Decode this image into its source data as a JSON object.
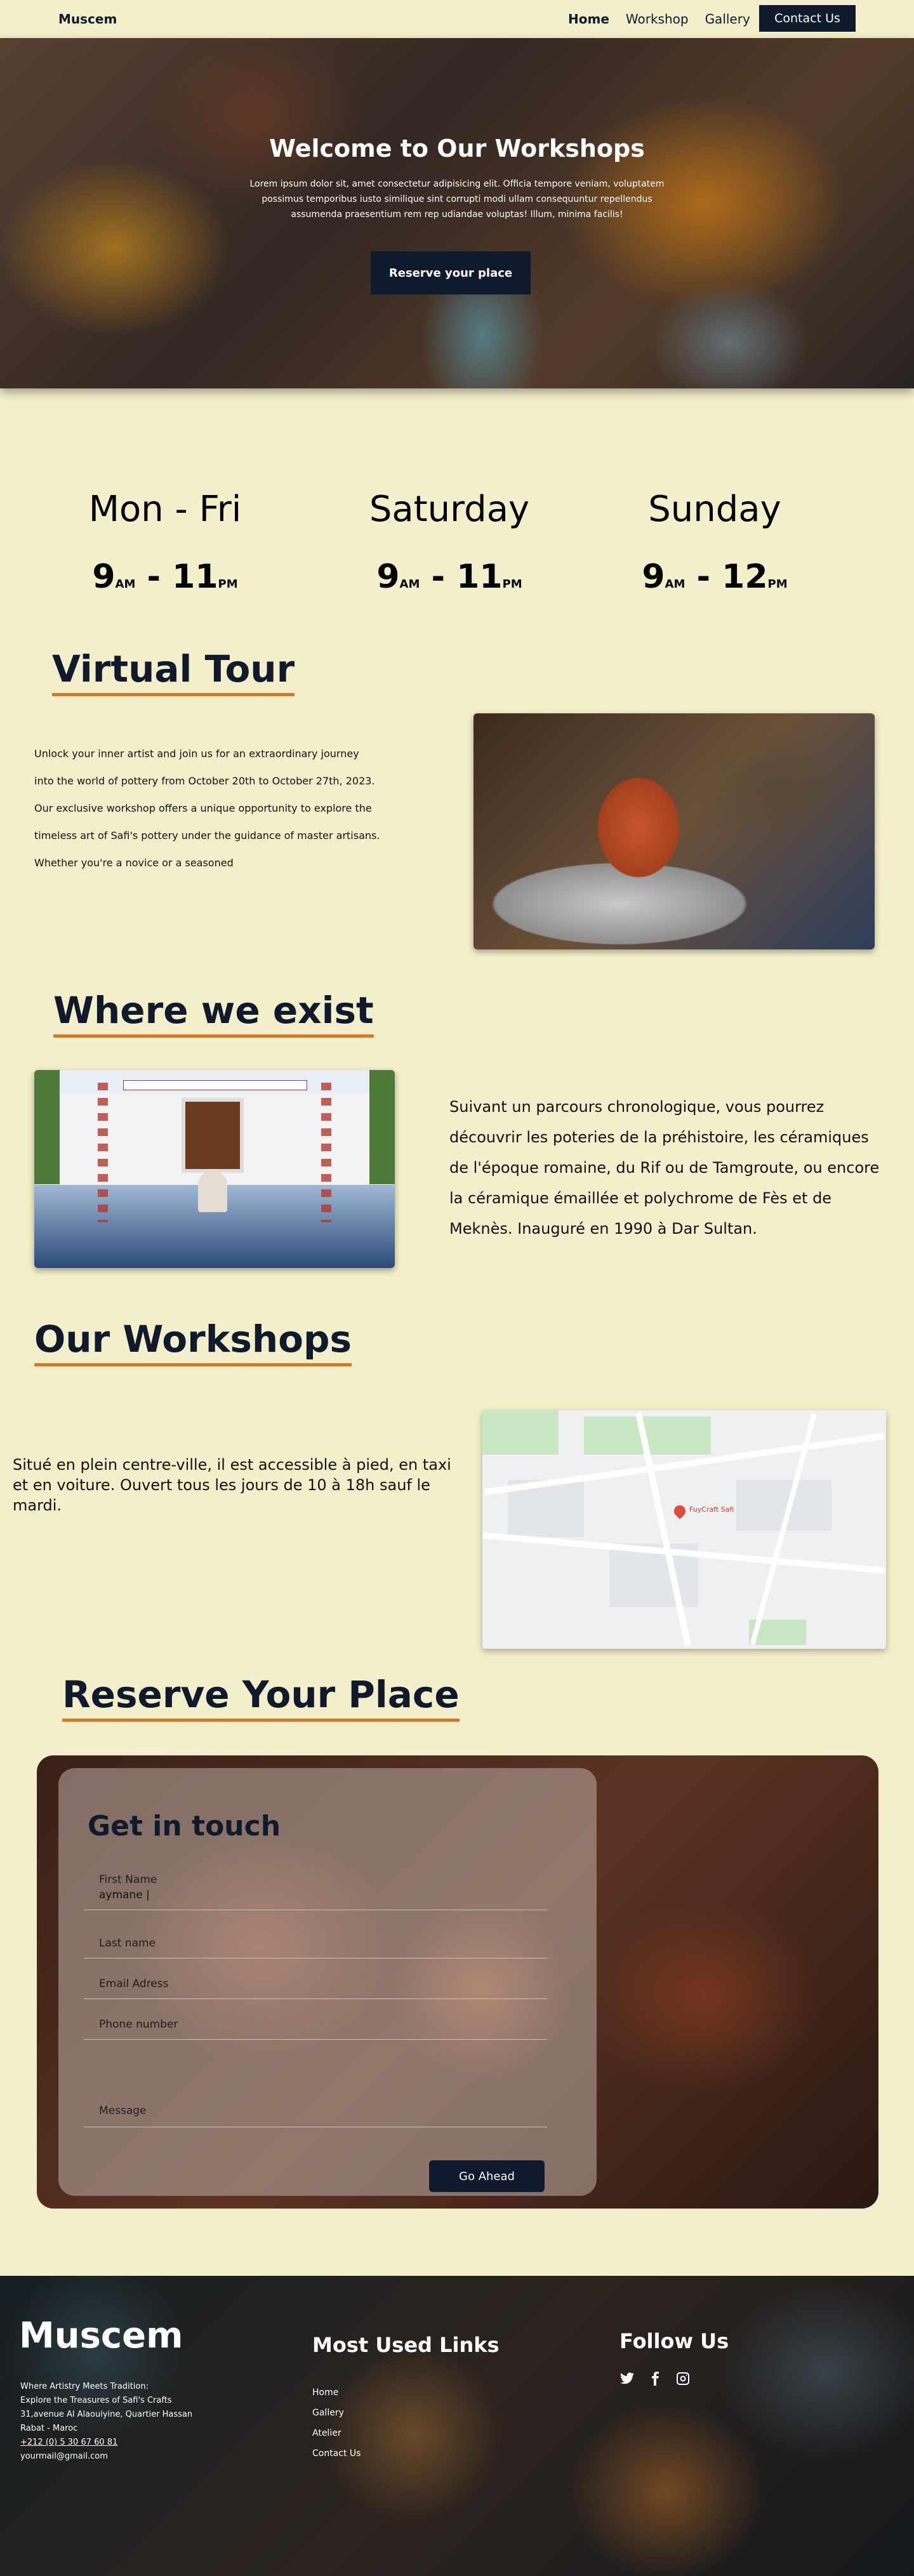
{
  "nav": {
    "brand": "Muscem",
    "links": [
      "Home",
      "Workshop",
      "Gallery"
    ],
    "contact": "Contact Us"
  },
  "hero": {
    "title": "Welcome to Our Workshops",
    "text": "Lorem ipsum dolor sit, amet consectetur adipisicing elit. Officia tempore veniam, voluptatem possimus temporibus iusto similique sint corrupti modi ullam consequuntur repellendus assumenda praesentium rem rep udiandae voluptas! Illum, minima facilis!",
    "button": "Reserve your place"
  },
  "schedule": [
    {
      "day": "Mon - Fri",
      "open": "9",
      "open_suffix": "AM",
      "sep": " - ",
      "close": "11",
      "close_suffix": "PM"
    },
    {
      "day": "Saturday",
      "open": "9",
      "open_suffix": "AM",
      "sep": " - ",
      "close": "11",
      "close_suffix": "PM"
    },
    {
      "day": "Sunday",
      "open": "9",
      "open_suffix": "AM",
      "sep": " - ",
      "close": "12",
      "close_suffix": "PM"
    }
  ],
  "virtual_tour": {
    "title": "Virtual Tour",
    "lines": [
      "Unlock your inner artist and join us for an extraordinary journey",
      "into the world of pottery from October 20th to October 27th, 2023.",
      "Our exclusive workshop offers a unique opportunity to explore the",
      "timeless art of Safi's pottery under the guidance of master artisans.",
      "Whether you're a novice or a seasoned"
    ]
  },
  "where": {
    "title": "Where we exist",
    "text": "Suivant un parcours chronologique, vous pourrez découvrir les poteries de la préhistoire, les céramiques de l'époque romaine, du Rif ou de Tamgroute, ou encore la céramique émaillée et polychrome de Fès et de Meknès. Inauguré en 1990 à Dar Sultan."
  },
  "workshops": {
    "title": "Our Workshops",
    "text": "Situé en plein centre-ville, il est accessible à pied, en taxi et en voiture. Ouvert tous les jours de 10 à 18h sauf le mardi.",
    "map_pin": "FuyCraft Safi"
  },
  "reserve": {
    "title": "Reserve Your Place",
    "form_title": "Get in touch",
    "fields": [
      {
        "label": "First Name",
        "value": "aymane |"
      },
      {
        "label": "Last name",
        "value": ""
      },
      {
        "label": "Email Adress",
        "value": ""
      },
      {
        "label": "Phone number",
        "value": ""
      },
      {
        "label": "Message",
        "value": ""
      }
    ],
    "button": "Go Ahead"
  },
  "footer": {
    "brand": "Muscem",
    "lines": [
      "Where Artistry Meets Tradition:",
      " Explore the Treasures of Safi's Crafts",
      "31,avenue Al Alaouiyine, Quartier Hassan",
      "Rabat - Maroc",
      "+212 (0) 5 30 67 60 81",
      "yourmail@gmail.com"
    ],
    "links_title": "Most Used Links",
    "links": [
      "Home",
      "Gallery",
      "Atelier",
      "Contact Us"
    ],
    "follow_title": "Follow Us",
    "socials": [
      "twitter-icon",
      "facebook-icon",
      "instagram-icon"
    ]
  },
  "colors": {
    "navy": "#0f1b2d",
    "accent": "#d5781f",
    "background": "#f3efcb"
  }
}
